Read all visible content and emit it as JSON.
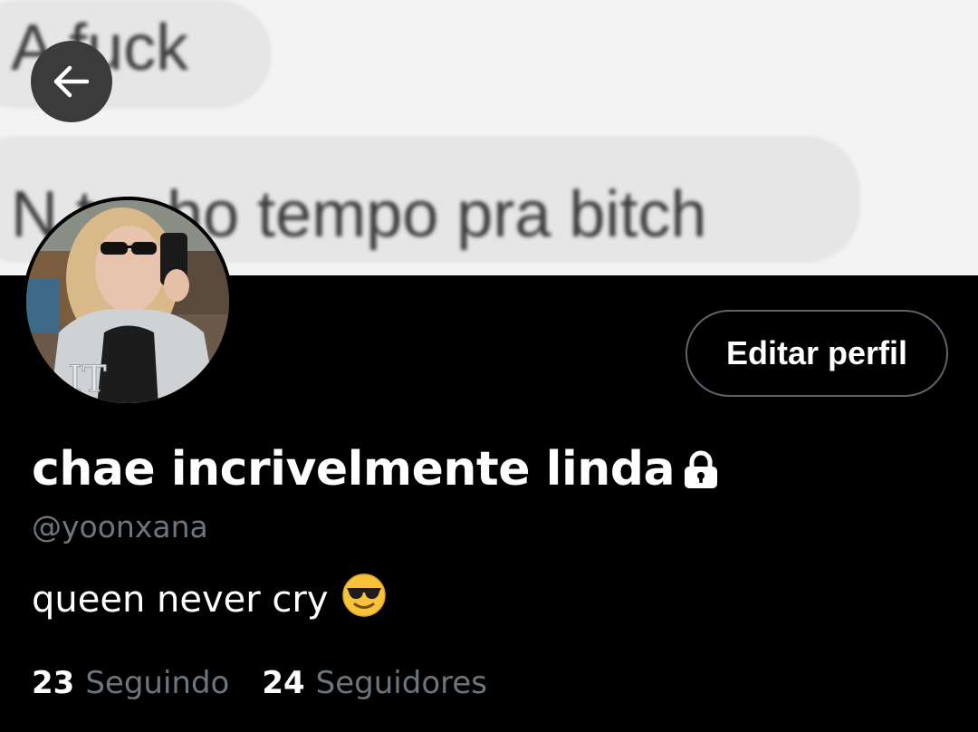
{
  "banner": {
    "chat_line_1": "A fuck",
    "chat_line_2": "N tenho tempo pra bitch"
  },
  "profile": {
    "display_name": "chae incrivelmente linda",
    "handle": "@yoonxana",
    "bio": "queen never cry",
    "bio_emoji": "smiling-face-with-sunglasses-icon",
    "edit_button_label": "Editar perfil",
    "protected": true
  },
  "stats": {
    "following_count": "23",
    "following_label": "Seguindo",
    "followers_count": "24",
    "followers_label": "Seguidores"
  },
  "icons": {
    "back": "arrow-left-icon",
    "lock": "lock-icon"
  },
  "colors": {
    "background": "#000000",
    "muted_text": "#6e767d",
    "button_border": "#5c646c",
    "back_button_bg": "#3b3b3b"
  }
}
